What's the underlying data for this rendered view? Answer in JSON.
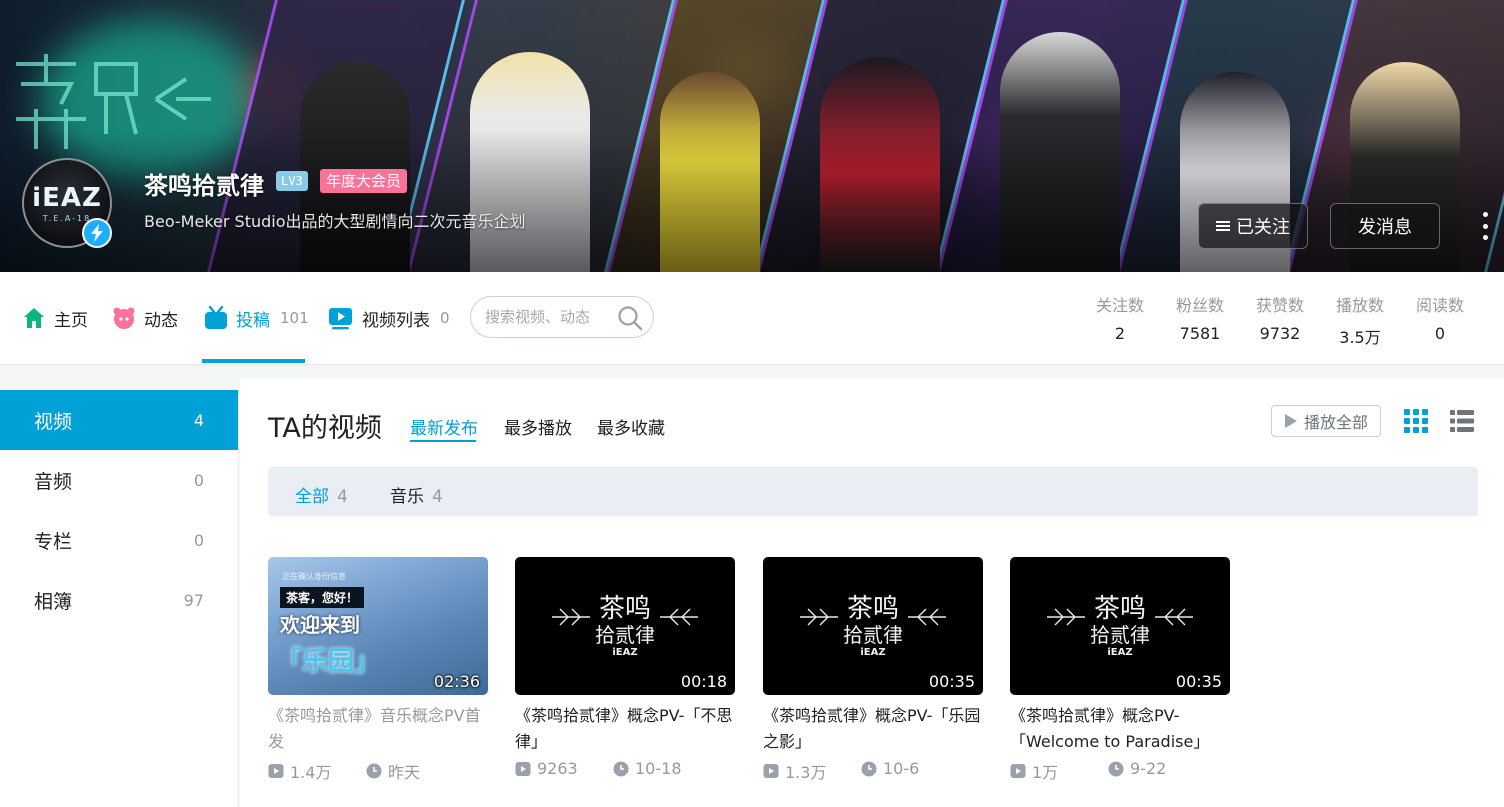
{
  "profile": {
    "avatar_main": "iEAZ",
    "avatar_sub": "T.E.A-18",
    "name": "茶鸣拾贰律",
    "level": "LV3",
    "vip": "年度大会员",
    "sign": "Beo-Meker Studio出品的大型剧情向二次元音乐企划",
    "follow_label": "已关注",
    "message_label": "发消息"
  },
  "nav": {
    "items": [
      {
        "label": "主页",
        "count": ""
      },
      {
        "label": "动态",
        "count": ""
      },
      {
        "label": "投稿",
        "count": "101"
      },
      {
        "label": "视频列表",
        "count": "0"
      }
    ],
    "search_placeholder": "搜索视频、动态"
  },
  "stats": [
    {
      "label": "关注数",
      "value": "2"
    },
    {
      "label": "粉丝数",
      "value": "7581"
    },
    {
      "label": "获赞数",
      "value": "9732"
    },
    {
      "label": "播放数",
      "value": "3.5万"
    },
    {
      "label": "阅读数",
      "value": "0"
    }
  ],
  "sidebar": {
    "items": [
      {
        "label": "视频",
        "count": "4"
      },
      {
        "label": "音频",
        "count": "0"
      },
      {
        "label": "专栏",
        "count": "0"
      },
      {
        "label": "相簿",
        "count": "97"
      }
    ]
  },
  "main": {
    "title": "TA的视频",
    "sort_tabs": [
      "最新发布",
      "最多播放",
      "最多收藏"
    ],
    "play_all": "播放全部",
    "filters": [
      {
        "label": "全部",
        "count": "4"
      },
      {
        "label": "音乐",
        "count": "4"
      }
    ]
  },
  "videos": [
    {
      "title": "《茶鸣拾贰律》音乐概念PV首发",
      "duration": "02:36",
      "plays": "1.4万",
      "date": "昨天",
      "thumb_text1": "正在确认身份信息",
      "thumb_text2": "茶客，您好！",
      "thumb_text3": "欢迎来到",
      "thumb_text4": "「乐园」"
    },
    {
      "title": "《茶鸣拾贰律》概念PV-「不思律」",
      "duration": "00:18",
      "plays": "9263",
      "date": "10-18",
      "brand_top": "茶鸣",
      "brand_mid": "拾贰律",
      "brand_bottom": "iEAZ"
    },
    {
      "title": "《茶鸣拾贰律》概念PV-「乐园之影」",
      "duration": "00:35",
      "plays": "1.3万",
      "date": "10-6",
      "brand_top": "茶鸣",
      "brand_mid": "拾贰律",
      "brand_bottom": "iEAZ"
    },
    {
      "title": "《茶鸣拾贰律》概念PV-「Welcome to Paradise」",
      "duration": "00:35",
      "plays": "1万",
      "date": "9-22",
      "brand_top": "茶鸣",
      "brand_mid": "拾贰律",
      "brand_bottom": "iEAZ"
    }
  ],
  "colors": {
    "accent": "#00a1d6",
    "vip_pink": "#fb7299",
    "level_blue": "#87cbe8"
  }
}
